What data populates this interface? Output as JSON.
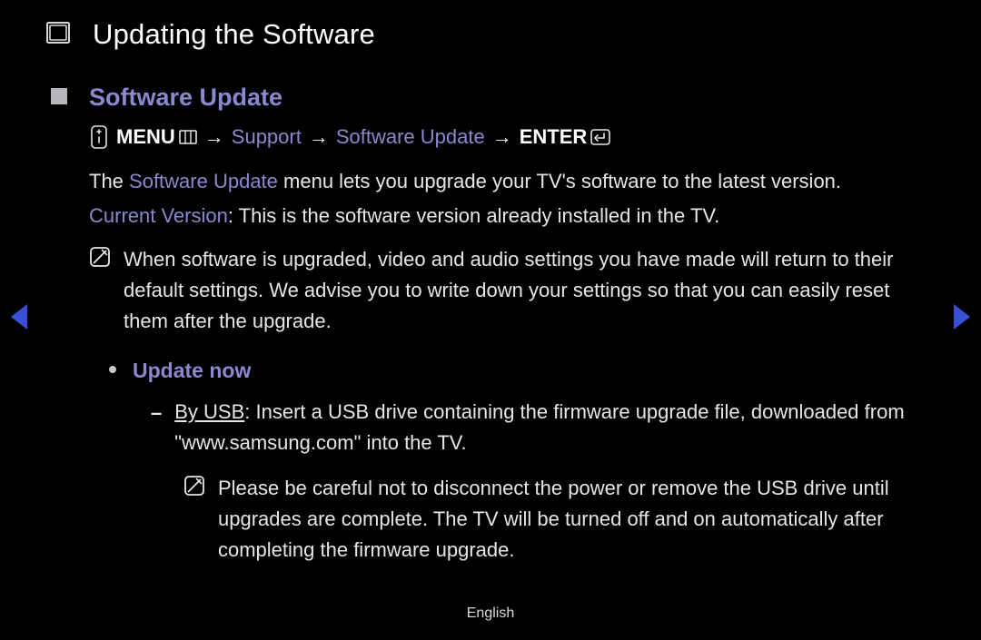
{
  "page": {
    "title": "Updating the Software",
    "footer": "English"
  },
  "section": {
    "title": "Software Update",
    "nav": {
      "menu": "MENU",
      "arrow": "→",
      "support": "Support",
      "software_update": "Software Update",
      "enter": "ENTER"
    },
    "intro": {
      "pre": "The ",
      "link": "Software Update",
      "post": " menu lets you upgrade your TV's software to the latest version."
    },
    "current_version": {
      "label": "Current Version",
      "text": ": This is the software version already installed in the TV."
    },
    "note1": "When software is upgraded, video and audio settings you have made will return to their default settings. We advise you to write down your settings so that you can easily reset them after the upgrade.",
    "update_now": {
      "title": "Update now",
      "by_usb": {
        "label": "By USB",
        "text": ": Insert a USB drive containing the firmware upgrade file, downloaded from \"www.samsung.com\" into the TV."
      },
      "note2": "Please be careful not to disconnect the power or remove the USB drive until upgrades are complete. The TV will be turned off and on automatically after completing the firmware upgrade."
    }
  }
}
